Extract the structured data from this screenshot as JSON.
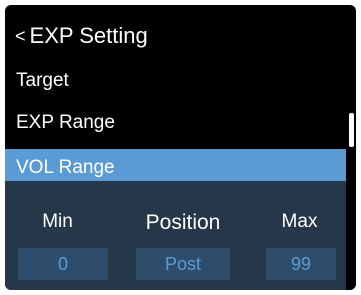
{
  "header": {
    "back_icon": "<",
    "title": "EXP Setting"
  },
  "menu": {
    "items": [
      {
        "label": "Target"
      },
      {
        "label": "EXP Range"
      },
      {
        "label": "VOL Range"
      }
    ],
    "selected_index": 2
  },
  "panel": {
    "min_label": "Min",
    "position_label": "Position",
    "max_label": "Max",
    "min_value": "0",
    "position_value": "Post",
    "max_value": "99"
  },
  "colors": {
    "accent": "#5b9bd5",
    "panel_bg": "#253748",
    "value_bg": "#2e4d6b",
    "screen_bg": "#000000"
  }
}
